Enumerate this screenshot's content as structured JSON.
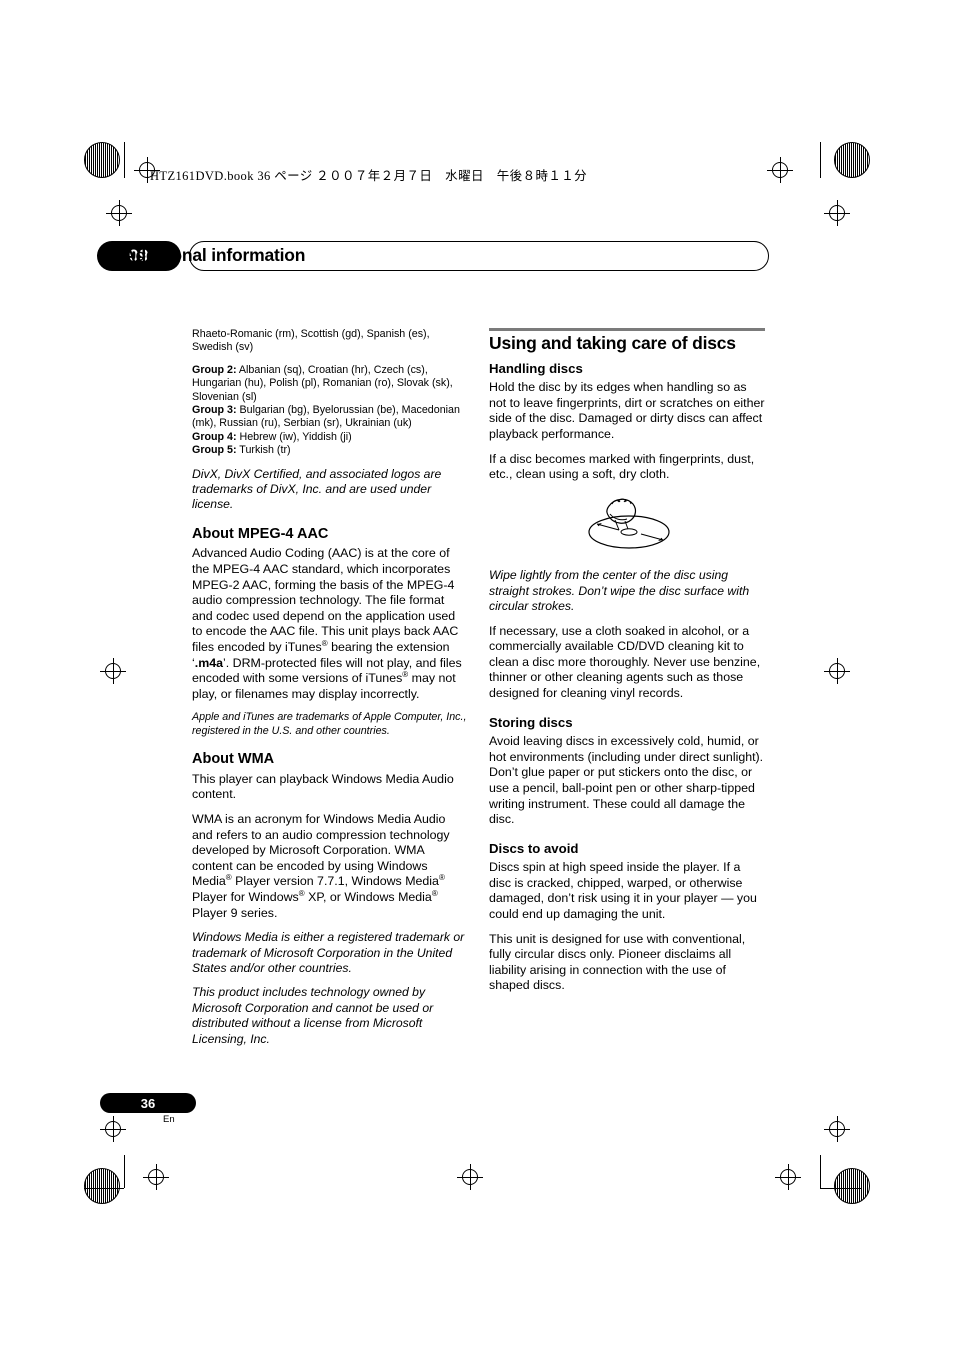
{
  "page": {
    "fileinfo": "HTZ161DVD.book  36 ページ  ２００７年２月７日　水曜日　午後８時１１分",
    "chapter_number": "09",
    "chapter_title": "Additional information",
    "page_number": "36",
    "page_lang": "En"
  },
  "left_column": {
    "lang_intro": "Rhaeto-Romanic (rm), Scottish (gd), Spanish (es), Swedish (sv)",
    "groups": [
      {
        "label": "Group 2:",
        "text": " Albanian (sq), Croatian (hr), Czech (cs), Hungarian (hu), Polish (pl), Romanian (ro), Slovak (sk), Slovenian (sl)"
      },
      {
        "label": "Group 3:",
        "text": " Bulgarian (bg), Byelorussian (be), Macedonian (mk), Russian (ru), Serbian (sr), Ukrainian (uk)"
      },
      {
        "label": "Group 4:",
        "text": " Hebrew (iw), Yiddish (ji)"
      },
      {
        "label": "Group 5:",
        "text": " Turkish (tr)"
      }
    ],
    "divx_note": "DivX, DivX Certified, and associated logos are trademarks of DivX, Inc. and are used under license.",
    "aac_heading": "About MPEG-4 AAC",
    "aac_p1_a": "Advanced Audio Coding (AAC) is at the core of the MPEG-4 AAC standard, which incorporates MPEG-2 AAC, forming the basis of the MPEG-4 audio compression technology. The file format and codec used depend on the application used to encode the AAC file. This unit plays back AAC files encoded by iTunes",
    "aac_p1_b": " bearing the extension ‘",
    "aac_p1_m4a": ".m4a",
    "aac_p1_c": "’. DRM-protected files will not play, and files encoded with some versions of iTunes",
    "aac_p1_d": " may not play, or filenames may display incorrectly.",
    "apple_note": "Apple and iTunes are trademarks of Apple Computer, Inc., registered in the U.S. and other countries.",
    "wma_heading": "About WMA",
    "wma_p1": "This player can playback Windows Media Audio content.",
    "wma_p2_a": "WMA is an acronym for Windows Media Audio and refers to an audio compression technology developed by Microsoft Corporation. WMA content can be encoded by using Windows Media",
    "wma_p2_b": " Player version 7.7.1, Windows Media",
    "wma_p2_c": " Player for Windows",
    "wma_p2_d": " XP, or Windows Media",
    "wma_p2_e": " Player 9 series.",
    "wma_note1": "Windows Media is either a registered trademark or trademark of Microsoft Corporation in the United States and/or other countries.",
    "wma_note2": "This product includes technology owned by Microsoft Corporation and cannot be used or distributed without a license from Microsoft Licensing, Inc."
  },
  "right_column": {
    "section_heading": "Using and taking care of discs",
    "handling_heading": "Handling discs",
    "handling_p1": "Hold the disc by its edges when handling so as not to leave fingerprints, dirt or scratches on either side of the disc. Damaged or dirty discs can affect playback performance.",
    "handling_p2": "If a disc becomes marked with fingerprints, dust, etc., clean using a soft, dry cloth.",
    "figure_caption": "Wipe lightly from the center of the disc using straight strokes. Don’t wipe the disc surface with circular strokes.",
    "handling_p3": "If necessary, use a cloth soaked in alcohol, or a commercially available CD/DVD cleaning kit to clean a disc more thoroughly. Never use benzine, thinner or other cleaning agents such as those designed for cleaning vinyl records.",
    "storing_heading": "Storing discs",
    "storing_p1": "Avoid leaving discs in excessively cold, humid, or hot environments (including under direct sunlight). Don’t glue paper or put stickers onto the disc, or use a pencil, ball-point pen or other sharp-tipped writing instrument. These could all damage the disc.",
    "avoid_heading": "Discs to avoid",
    "avoid_p1": "Discs spin at high speed inside the player. If a disc is cracked, chipped, warped, or otherwise damaged, don’t risk using it in your player — you could end up damaging the unit.",
    "avoid_p2": "This unit is designed for use with conventional, fully circular discs only. Pioneer disclaims all liability arising in connection with the use of shaped discs."
  }
}
